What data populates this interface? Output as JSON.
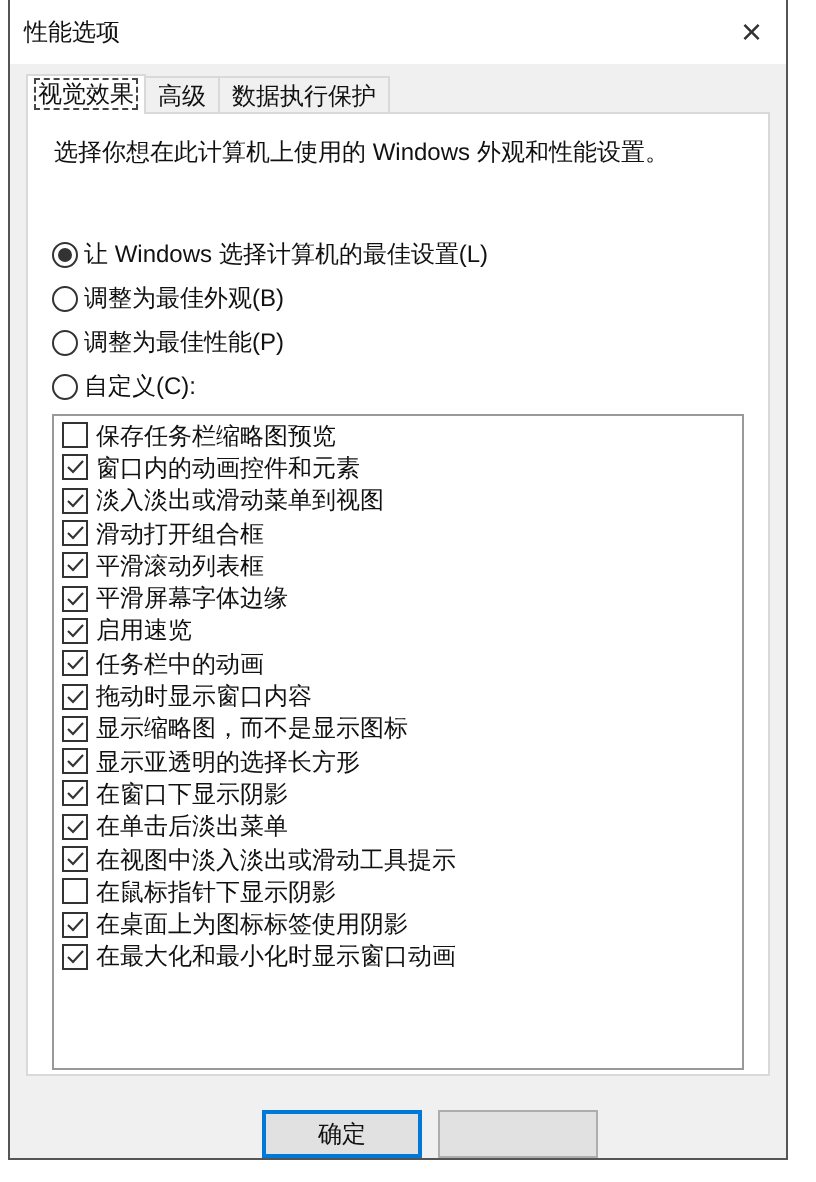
{
  "window": {
    "title": "性能选项",
    "close": "×"
  },
  "tabs": [
    {
      "label": "视觉效果",
      "selected": true
    },
    {
      "label": "高级",
      "selected": false
    },
    {
      "label": "数据执行保护",
      "selected": false
    }
  ],
  "description": "选择你想在此计算机上使用的 Windows 外观和性能设置。",
  "options": [
    {
      "label": "让 Windows 选择计算机的最佳设置(L)",
      "selected": true
    },
    {
      "label": "调整为最佳外观(B)",
      "selected": false
    },
    {
      "label": "调整为最佳性能(P)",
      "selected": false
    },
    {
      "label": "自定义(C):",
      "selected": false
    }
  ],
  "settings": [
    {
      "label": "保存任务栏缩略图预览",
      "checked": false
    },
    {
      "label": "窗口内的动画控件和元素",
      "checked": true
    },
    {
      "label": "淡入淡出或滑动菜单到视图",
      "checked": true
    },
    {
      "label": "滑动打开组合框",
      "checked": true
    },
    {
      "label": "平滑滚动列表框",
      "checked": true
    },
    {
      "label": "平滑屏幕字体边缘",
      "checked": true
    },
    {
      "label": "启用速览",
      "checked": true
    },
    {
      "label": "任务栏中的动画",
      "checked": true
    },
    {
      "label": "拖动时显示窗口内容",
      "checked": true
    },
    {
      "label": "显示缩略图，而不是显示图标",
      "checked": true
    },
    {
      "label": "显示亚透明的选择长方形",
      "checked": true
    },
    {
      "label": "在窗口下显示阴影",
      "checked": true
    },
    {
      "label": "在单击后淡出菜单",
      "checked": true
    },
    {
      "label": "在视图中淡入淡出或滑动工具提示",
      "checked": true
    },
    {
      "label": "在鼠标指针下显示阴影",
      "checked": false
    },
    {
      "label": "在桌面上为图标标签使用阴影",
      "checked": true
    },
    {
      "label": "在最大化和最小化时显示窗口动画",
      "checked": true
    }
  ],
  "buttons": [
    "确定"
  ]
}
